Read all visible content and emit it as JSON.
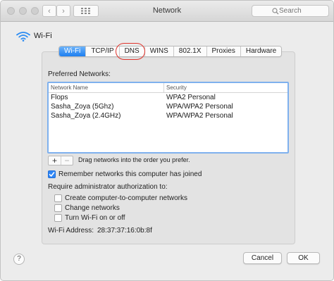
{
  "window": {
    "title": "Network"
  },
  "search": {
    "placeholder": "Search"
  },
  "header": {
    "label": "Wi-Fi"
  },
  "tabs": [
    {
      "label": "Wi-Fi",
      "active": true
    },
    {
      "label": "TCP/IP",
      "active": false
    },
    {
      "label": "DNS",
      "active": false,
      "highlighted": true
    },
    {
      "label": "WINS",
      "active": false
    },
    {
      "label": "802.1X",
      "active": false
    },
    {
      "label": "Proxies",
      "active": false
    },
    {
      "label": "Hardware",
      "active": false
    }
  ],
  "preferred": {
    "title": "Preferred Networks:",
    "columns": {
      "name": "Network Name",
      "security": "Security"
    },
    "rows": [
      {
        "name": "Flops",
        "security": "WPA2 Personal"
      },
      {
        "name": "Sasha_Zoya (5Ghz)",
        "security": "WPA/WPA2 Personal"
      },
      {
        "name": "Sasha_Zoya (2.4GHz)",
        "security": "WPA/WPA2 Personal"
      }
    ],
    "add_label": "+",
    "remove_label": "−",
    "hint": "Drag networks into the order you prefer."
  },
  "remember": {
    "label": "Remember networks this computer has joined",
    "checked": true
  },
  "require": {
    "title": "Require administrator authorization to:",
    "options": [
      {
        "label": "Create computer-to-computer networks",
        "checked": false
      },
      {
        "label": "Change networks",
        "checked": false
      },
      {
        "label": "Turn Wi-Fi on or off",
        "checked": false
      }
    ]
  },
  "address": {
    "label": "Wi-Fi Address:",
    "value": "28:37:37:16:0b:8f"
  },
  "footer": {
    "help_label": "?",
    "cancel_label": "Cancel",
    "ok_label": "OK"
  },
  "colors": {
    "accent": "#1d7ef0",
    "highlight_circle": "#e0342c",
    "selection_border": "#7fb1ee"
  },
  "icons": [
    "wifi-icon",
    "search-icon",
    "grid-icon",
    "chevron-left-icon",
    "chevron-right-icon",
    "checkmark-icon"
  ]
}
